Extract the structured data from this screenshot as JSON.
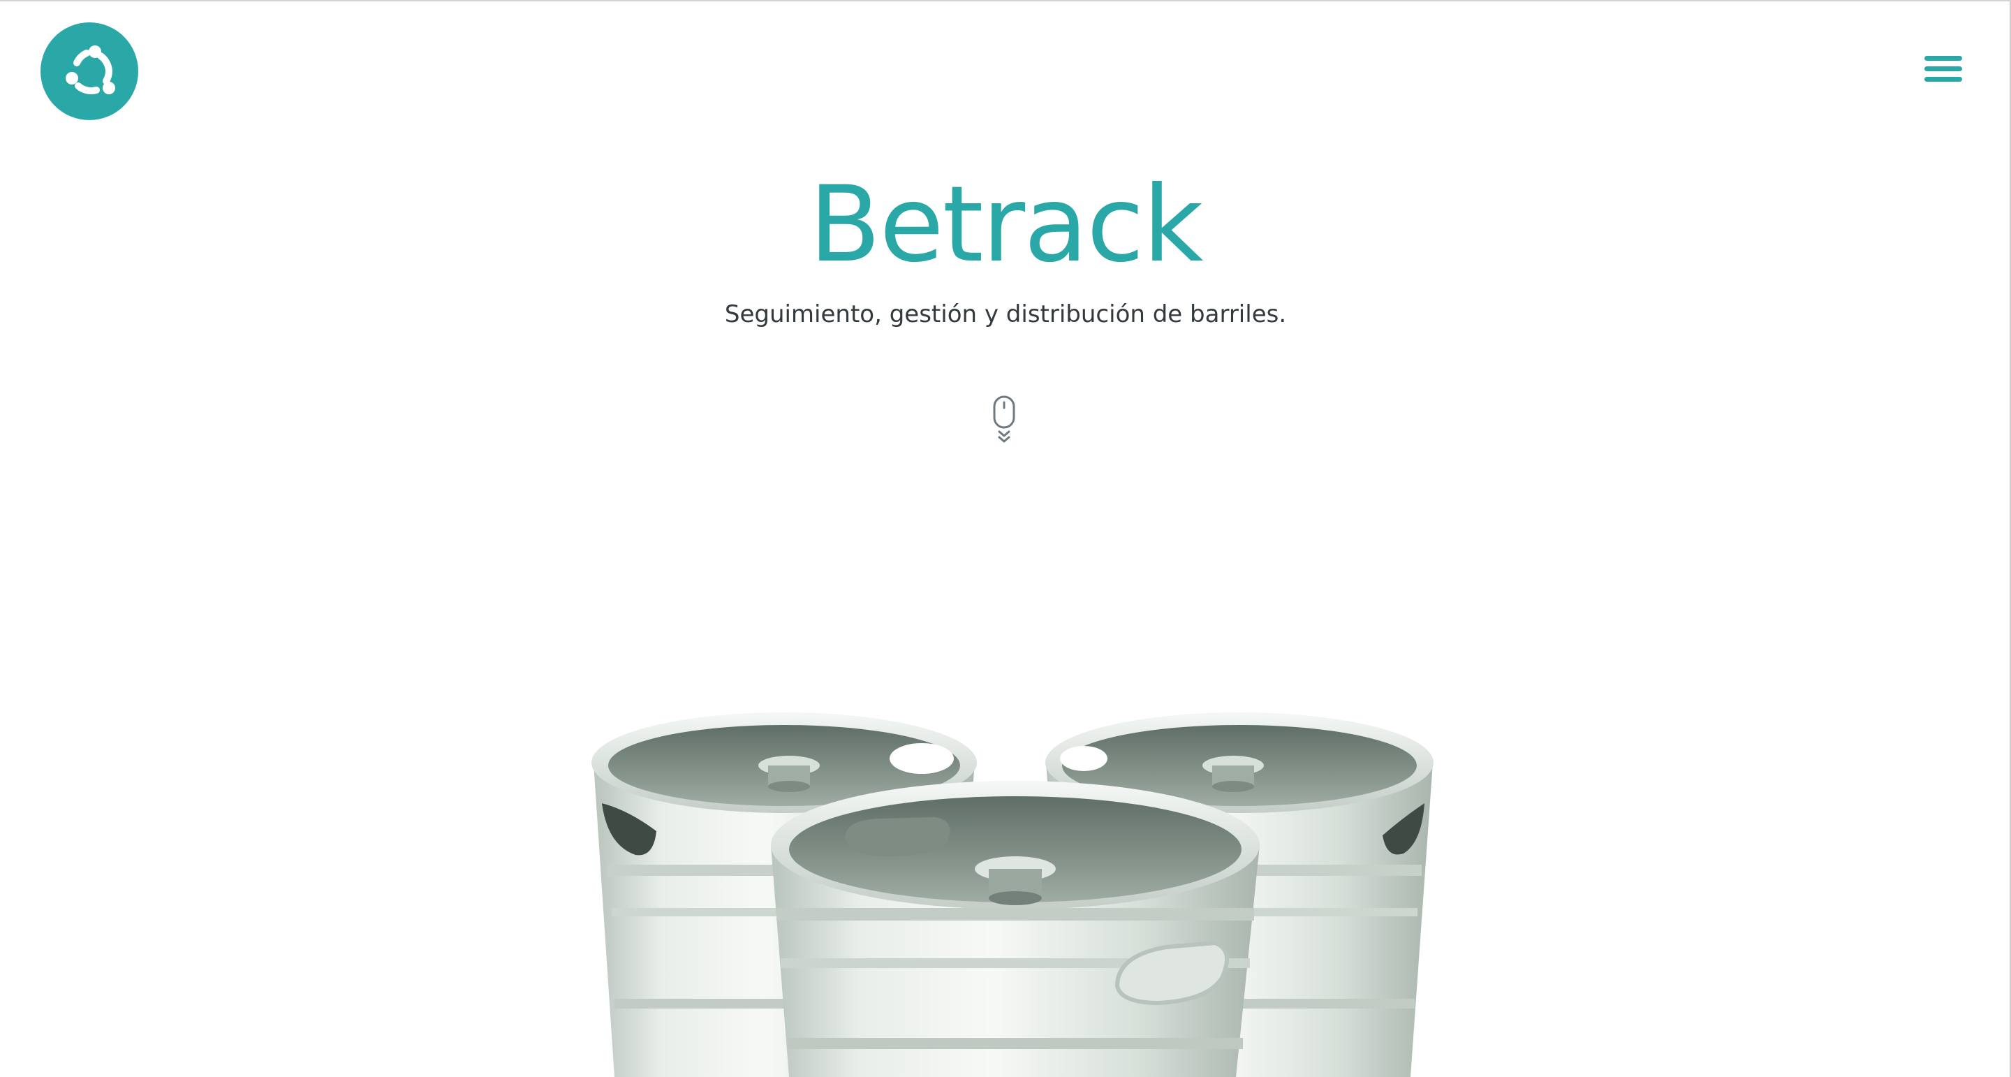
{
  "header": {
    "logo_icon": "share-nodes-icon",
    "menu_icon": "hamburger-menu-icon"
  },
  "hero": {
    "title": "Betrack",
    "subtitle": "Seguimiento, gestión y distribución de barriles.",
    "scroll_icon": "mouse-scroll-down-icon"
  },
  "illustration": {
    "name": "three-beer-kegs-image"
  },
  "colors": {
    "brand": "#2aa8a8",
    "text": "#333a3d",
    "background": "#ffffff"
  }
}
